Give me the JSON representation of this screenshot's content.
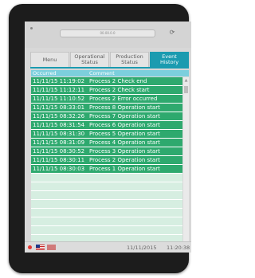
{
  "browser": {
    "address": "00.00.0.0"
  },
  "tabs": [
    {
      "label": "Menu",
      "active": false
    },
    {
      "label": "Operational\nStatus",
      "active": false
    },
    {
      "label": "Production\nStatus",
      "active": false
    },
    {
      "label": "Event\nHistory",
      "active": true
    }
  ],
  "table": {
    "headers": {
      "occurred": "Occurred",
      "comment": "Comment"
    },
    "rows": [
      {
        "occurred": "11/11/15 11:19:02",
        "comment": "Process 2 Check end"
      },
      {
        "occurred": "11/11/15 11:12:11",
        "comment": "Process 2 Check start"
      },
      {
        "occurred": "11/11/15 11:10:52",
        "comment": "Process 2 Error occurred"
      },
      {
        "occurred": "11/11/15 08:33:01",
        "comment": "Process 8 Operation start"
      },
      {
        "occurred": "11/11/15 08:32:26",
        "comment": "Process 7 Operation start"
      },
      {
        "occurred": "11/11/15 08:31:54",
        "comment": "Process 6 Operation start"
      },
      {
        "occurred": "11/11/15 08:31:30",
        "comment": "Process 5 Operation start"
      },
      {
        "occurred": "11/11/15 08:31:09",
        "comment": "Process 4 Operation start"
      },
      {
        "occurred": "11/11/15 08:30:52",
        "comment": "Process 3 Operation start"
      },
      {
        "occurred": "11/11/15 08:30:11",
        "comment": "Process 2 Operation start"
      },
      {
        "occurred": "11/11/15 08:30:03",
        "comment": "Process 1 Operation start"
      }
    ]
  },
  "footer": {
    "date": "11/11/2015",
    "time": "11:20:38"
  },
  "colors": {
    "accent": "#1b9bb0",
    "row_green": "#2ea96e",
    "header_light": "#7ccfdd"
  },
  "icons": {
    "reload": "reload-icon",
    "warning": "warning-icon",
    "flag_us": "us-flag-icon",
    "flag_secondary": "flag-icon"
  }
}
